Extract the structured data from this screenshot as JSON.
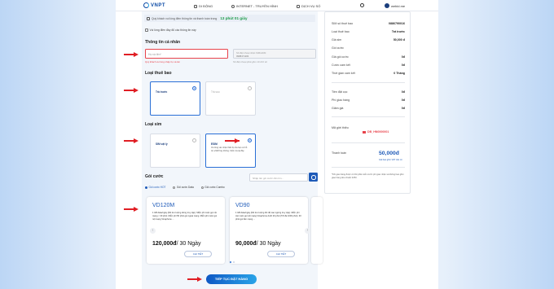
{
  "nav": {
    "brand": "VNPT",
    "items": [
      {
        "label": "DI ĐỘNG",
        "icon": "phone-icon"
      },
      {
        "label": "INTERNET - TRUYỀN HÌNH",
        "icon": "globe-icon"
      },
      {
        "label": "DỊCH VỤ SỐ",
        "icon": "apps-icon"
      }
    ],
    "search_icon": "search-icon",
    "user_name": "webid.me"
  },
  "notice": {
    "text": "Quý khách vui lòng điền thông tin và thanh toán trong",
    "timer": "13 phút 01 giây"
  },
  "form": {
    "checkbox_label": "Vui lòng điền đầy đủ các thông tin này",
    "personal_heading": "Thông tin cá nhân",
    "name_placeholder": "Họ và tên*",
    "name_error": "Quý khách vui lòng nhập họ và tên",
    "phone_label": "Số điện thoại nhận SIM/eSIM",
    "phone_value": "0988471184",
    "phone_note": "Số điện thoại phải gồm 10 chữ số",
    "sub_type_heading": "Loại thuê bao",
    "sub_types": [
      {
        "label": "Trả trước",
        "selected": true
      },
      {
        "label": "Trả sau",
        "selected": false
      }
    ],
    "sim_type_heading": "Loại sim",
    "sim_types": [
      {
        "label": "SIM vật lý",
        "selected": false,
        "desc": ""
      },
      {
        "label": "ESIM",
        "selected": true,
        "desc": "Vui lòng xác nhận thiết bị của bạn có hỗ trợ eSIM hay không. Kiểm tra tại đây"
      }
    ],
    "packages_heading": "Gói cước",
    "package_search_placeholder": "Nhập tên gói cước cần tìm...",
    "package_tabs": [
      {
        "label": "Gói cước HOT",
        "active": true
      },
      {
        "label": "Gói cước Data",
        "active": false
      },
      {
        "label": "Gói cước Combo",
        "active": false
      }
    ],
    "packages": [
      {
        "name": "VD120M",
        "desc": "1 GB data/ngày (hết lưu lượng dừng truy cập). Miễn phí cuộc gọi nội mạng < 20 phút. Miễn phí 50 phút gọi ngoại mạng. Miễn phí cuộc gọi nội mạng Vinaphone ...",
        "price": "120,000đ",
        "period": "/ 30 Ngày",
        "detail": "CHI TIẾT"
      },
      {
        "name": "VD90",
        "desc": "1 GB data/ngày (hết lưu lượng tốc độ cao ngừng truy cập). Miễn phí các cuộc gọi nội mạng Vinaphone dưới 20 phút (Tối đa 1000 phút). 30 phút gọi liên mạng ...",
        "price": "90,000đ",
        "period": "/ 30 Ngày",
        "detail": "CHI TIẾT"
      }
    ],
    "cta": "TIẾP TỤC ĐẶT HÀNG"
  },
  "summary": {
    "rows1": [
      {
        "label": "SIM số thuê bao",
        "value": "0886790016"
      },
      {
        "label": "Loại thuê bao",
        "value": "Trả trước"
      },
      {
        "label": "Giá sim",
        "value": "50,000 đ"
      },
      {
        "label": "Gói cước",
        "value": ""
      },
      {
        "label": "Giá gói cước",
        "value": "0đ"
      },
      {
        "label": "Cước cam kết",
        "value": "0đ"
      },
      {
        "label": "Thời gian cam kết",
        "value": "0 Tháng"
      }
    ],
    "rows2": [
      {
        "label": "Tiền đặt cọc",
        "value": "0đ"
      },
      {
        "label": "Phí giao hàng",
        "value": "0đ"
      },
      {
        "label": "Giảm giá",
        "value": "0đ"
      }
    ],
    "promo_label": "Mã giới thiệu",
    "promo_code": "DB_HN0000001",
    "pay_label": "Thanh toán",
    "total": "50,000đ",
    "total_note": "Giá bao gồm VAT nếu có",
    "footnote": "*Khi giao hàng được có thể phải miễn cước phí giao nhận và không bao gồm giao hàng tiêu chuẩn 0253."
  },
  "colors": {
    "accent": "#1e5ab8",
    "error": "#e8434b",
    "pointer": "#e01e24"
  }
}
